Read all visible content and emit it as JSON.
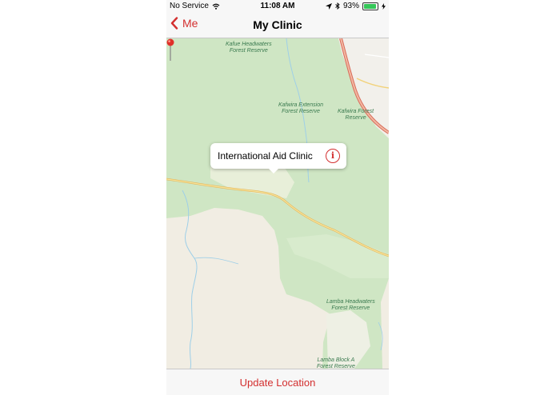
{
  "status_bar": {
    "carrier": "No Service",
    "time": "11:08 AM",
    "battery_percent": "93%",
    "battery_level": 0.93
  },
  "nav": {
    "back_label": "Me",
    "title": "My Clinic"
  },
  "map": {
    "labels": {
      "kafue": "Kafue Headwaters\nForest Reserve",
      "kafwira_ext": "Kafwira Extension\nForest Reserve",
      "kafwira": "Kafwira Forest\nReserve",
      "lamba_head": "Lamba Headwaters\nForest Reserve",
      "lamba_block": "Lamba Block A\nForest Reserve"
    },
    "callout_title": "International Aid Clinic"
  },
  "toolbar": {
    "update_label": "Update Location"
  },
  "colors": {
    "accent": "#d32f2f",
    "forest": "#cfe6c4",
    "road": "#f2d27a"
  }
}
